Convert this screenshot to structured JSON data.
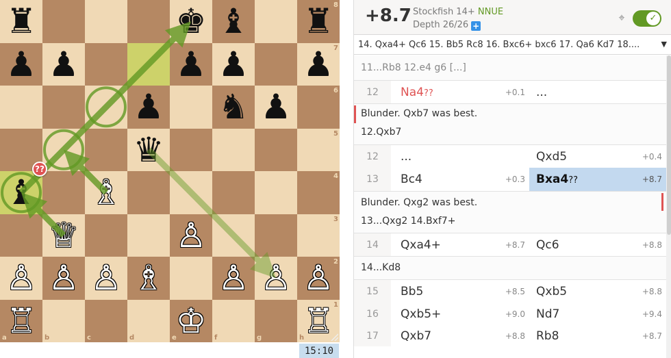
{
  "board": {
    "files": [
      "a",
      "b",
      "c",
      "d",
      "e",
      "f",
      "g",
      "h"
    ],
    "ranks": [
      "8",
      "7",
      "6",
      "5",
      "4",
      "3",
      "2",
      "1"
    ],
    "colors": {
      "light": "#f0d9b5",
      "dark": "#b58863",
      "highlight": "#cdd26a",
      "arrow": "#629924"
    },
    "highlighted_squares": [
      "d7",
      "a4"
    ],
    "pieces": [
      {
        "sq": "a8",
        "p": "rook",
        "c": "b",
        "g": "♜"
      },
      {
        "sq": "e8",
        "p": "king",
        "c": "b",
        "g": "♚"
      },
      {
        "sq": "f8",
        "p": "bishop",
        "c": "b",
        "g": "♝"
      },
      {
        "sq": "h8",
        "p": "rook",
        "c": "b",
        "g": "♜"
      },
      {
        "sq": "a7",
        "p": "pawn",
        "c": "b",
        "g": "♟"
      },
      {
        "sq": "b7",
        "p": "pawn",
        "c": "b",
        "g": "♟"
      },
      {
        "sq": "e7",
        "p": "pawn",
        "c": "b",
        "g": "♟"
      },
      {
        "sq": "f7",
        "p": "pawn",
        "c": "b",
        "g": "♟"
      },
      {
        "sq": "h7",
        "p": "pawn",
        "c": "b",
        "g": "♟"
      },
      {
        "sq": "d6",
        "p": "pawn",
        "c": "b",
        "g": "♟"
      },
      {
        "sq": "f6",
        "p": "knight",
        "c": "b",
        "g": "♞"
      },
      {
        "sq": "g6",
        "p": "pawn",
        "c": "b",
        "g": "♟"
      },
      {
        "sq": "d5",
        "p": "queen",
        "c": "b",
        "g": "♛"
      },
      {
        "sq": "a4",
        "p": "bishop",
        "c": "b",
        "g": "♝"
      },
      {
        "sq": "c4",
        "p": "bishop",
        "c": "w",
        "g": "♗"
      },
      {
        "sq": "b3",
        "p": "queen",
        "c": "w",
        "g": "♕"
      },
      {
        "sq": "e3",
        "p": "pawn",
        "c": "w",
        "g": "♙"
      },
      {
        "sq": "a2",
        "p": "pawn",
        "c": "w",
        "g": "♙"
      },
      {
        "sq": "b2",
        "p": "pawn",
        "c": "w",
        "g": "♙"
      },
      {
        "sq": "c2",
        "p": "pawn",
        "c": "w",
        "g": "♙"
      },
      {
        "sq": "d2",
        "p": "bishop",
        "c": "w",
        "g": "♗"
      },
      {
        "sq": "f2",
        "p": "pawn",
        "c": "w",
        "g": "♙"
      },
      {
        "sq": "g2",
        "p": "pawn",
        "c": "w",
        "g": "♙"
      },
      {
        "sq": "h2",
        "p": "pawn",
        "c": "w",
        "g": "♙"
      },
      {
        "sq": "a1",
        "p": "rook",
        "c": "w",
        "g": "♖"
      },
      {
        "sq": "e1",
        "p": "king",
        "c": "w",
        "g": "♔"
      },
      {
        "sq": "h1",
        "p": "rook",
        "c": "w",
        "g": "♖"
      }
    ],
    "arrows": [
      {
        "from": "a4",
        "to": "e8",
        "opacity": 0.8
      },
      {
        "from": "b3",
        "to": "a4",
        "opacity": 0.8
      },
      {
        "from": "c4",
        "to": "b5",
        "opacity": 0.8
      },
      {
        "from": "d5",
        "to": "g2",
        "opacity": 0.45
      }
    ],
    "circles": [
      "c6",
      "b5",
      "a4"
    ],
    "blunder_badge": "??",
    "blunder_badge_square": "a4"
  },
  "clock": "15:10",
  "ceval": {
    "score": "+8.7",
    "engine": "Stockfish 14+",
    "nnue": "NNUE",
    "depth": "Depth 26/26",
    "depth_plus": "+",
    "target_icon": "⌖",
    "toggle_check": "✓"
  },
  "pv": {
    "text": "14. Qxa4+ Qc6 15. Bb5 Rc8 16. Bxc6+ bxc6 17. Qa6 Kd7 18....",
    "caret": "▼"
  },
  "moves": {
    "variation_top": "11...Rb8 12.e4 g6 [...]",
    "row12a": {
      "idx": "12",
      "white": "Na4",
      "white_glyph": "??",
      "white_eval": "+0.1",
      "black": "..."
    },
    "comment1": {
      "text": "Blunder. Qxb7 was best.",
      "variation": "12.Qxb7"
    },
    "row12b": {
      "idx": "12",
      "white": "...",
      "white_eval": "",
      "black": "Qxd5",
      "black_eval": "+0.4"
    },
    "row13": {
      "idx": "13",
      "white": "Bc4",
      "white_eval": "+0.3",
      "black": "Bxa4",
      "black_glyph": "??",
      "black_eval": "+8.7"
    },
    "comment2": {
      "text": "Blunder. Qxg2 was best.",
      "variation": "13...Qxg2 14.Bxf7+"
    },
    "row14": {
      "idx": "14",
      "white": "Qxa4+",
      "white_eval": "+8.7",
      "black": "Qc6",
      "black_eval": "+8.8"
    },
    "var14": "14...Kd8",
    "row15": {
      "idx": "15",
      "white": "Bb5",
      "white_eval": "+8.5",
      "black": "Qxb5",
      "black_eval": "+8.8"
    },
    "row16": {
      "idx": "16",
      "white": "Qxb5+",
      "white_eval": "+9.0",
      "black": "Nd7",
      "black_eval": "+9.4"
    },
    "row17": {
      "idx": "17",
      "white": "Qxb7",
      "white_eval": "+8.8",
      "black": "Rb8",
      "black_eval": "+8.7"
    }
  }
}
